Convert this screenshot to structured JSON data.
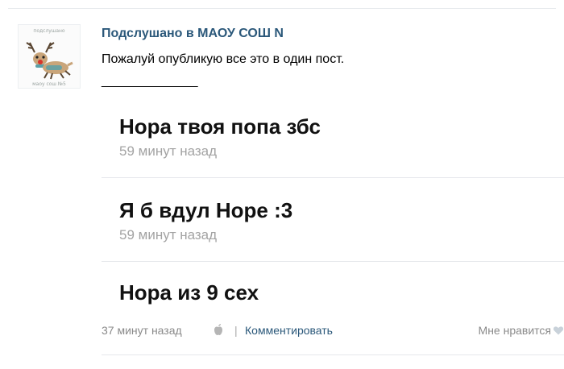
{
  "post": {
    "group_name": "Подслушано в МАОУ СОШ N",
    "text": "Пожалуй опубликую все это в один пост.",
    "separator": "_______________",
    "avatar": {
      "top_caption": "подслушано",
      "bottom_caption": "маоу сош №5"
    }
  },
  "messages": [
    {
      "title": "Нора твоя попа збс",
      "time": "59 минут назад"
    },
    {
      "title": "Я б вдул Норе :3",
      "time": "59 минут назад"
    },
    {
      "title": "Нора из 9 сех",
      "time": ""
    }
  ],
  "footer": {
    "time": "37 минут назад",
    "separator": "|",
    "comment_label": "Комментировать",
    "like_label": "Мне нравится",
    "platform_icon": "apple-icon",
    "like_icon": "heart-icon"
  },
  "colors": {
    "link": "#2b587a",
    "muted": "#a3a3a3",
    "divider": "#e6e8ec"
  }
}
